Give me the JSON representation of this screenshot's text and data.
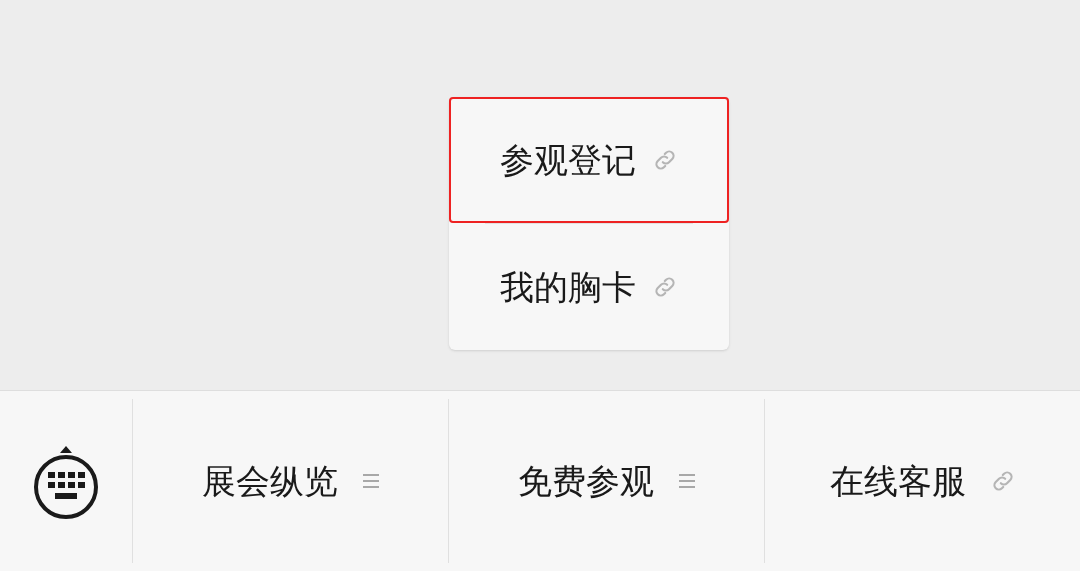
{
  "submenu": {
    "items": [
      {
        "label": "参观登记",
        "kind": "link",
        "selected": true
      },
      {
        "label": "我的胸卡",
        "kind": "link",
        "selected": false
      }
    ]
  },
  "menu_bar": {
    "items": [
      {
        "label": "展会纵览",
        "kind": "submenu",
        "expanded": false
      },
      {
        "label": "免费参观",
        "kind": "submenu",
        "expanded": true
      },
      {
        "label": "在线客服",
        "kind": "link",
        "expanded": false
      }
    ]
  }
}
